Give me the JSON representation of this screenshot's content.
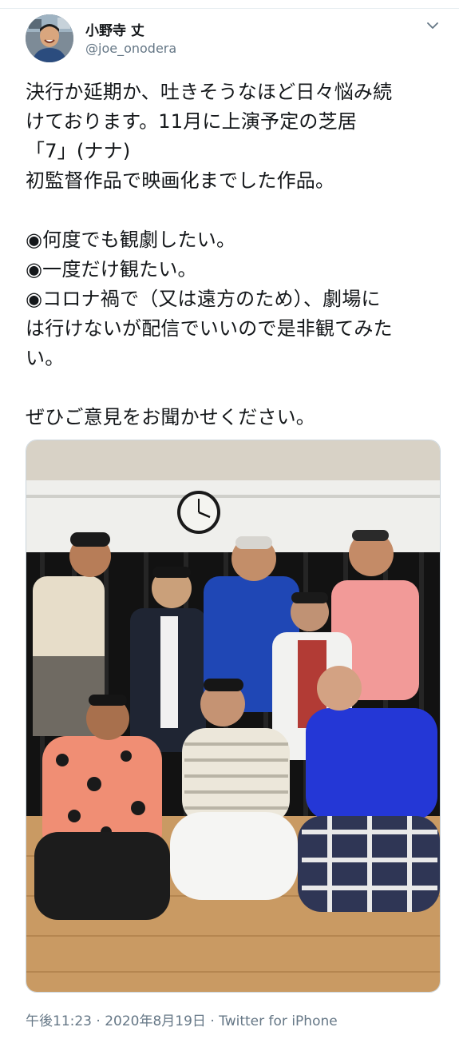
{
  "author": {
    "display_name": "小野寺 丈",
    "handle": "@joe_onodera",
    "avatar_icon": "avatar-photo"
  },
  "menu": {
    "icon": "chevron-down-icon"
  },
  "tweet": {
    "lines": [
      "決行か延期か、吐きそうなほど日々悩み続",
      "けております。11月に上演予定の芝居",
      "「7」(ナナ)",
      "初監督作品で映画化までした作品。",
      "",
      "◉何度でも観劇したい。",
      "◉一度だけ観たい。",
      "◉コロナ禍で（又は遠方のため）、劇場に",
      "は行けないが配信でいいので是非観てみた",
      "い。",
      "",
      "ぜひご意見をお聞かせください。"
    ]
  },
  "media": {
    "description_icon": "group-photo-image"
  },
  "footer": {
    "time": "午後11:23",
    "separator": " · ",
    "date": "2020年8月19日",
    "source": "Twitter for iPhone"
  },
  "colors": {
    "text": "#14171a",
    "secondary": "#657786",
    "border": "#ccd6dd"
  }
}
